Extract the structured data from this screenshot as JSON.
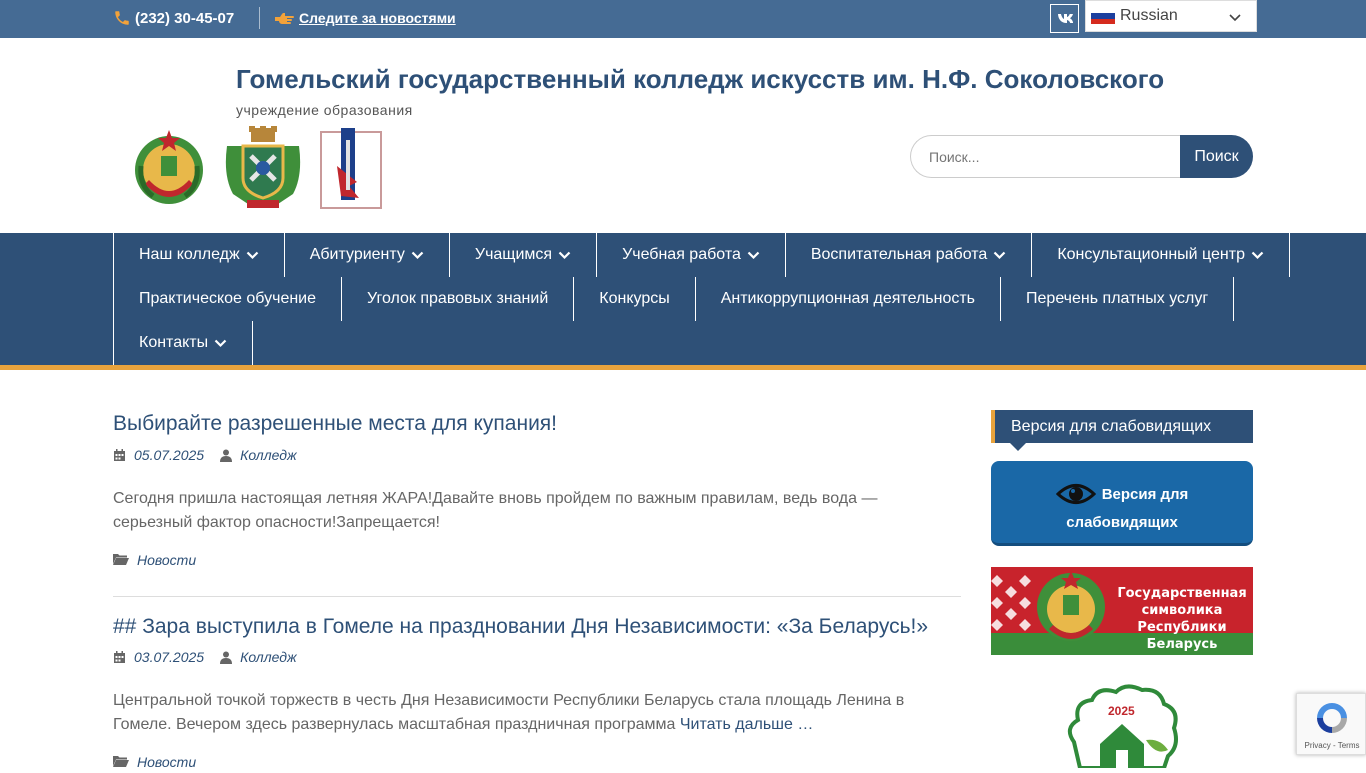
{
  "topbar": {
    "phone": "(232) 30-45-07",
    "news_link": "Следите за новостями",
    "vk_label": "VK",
    "language": "Russian"
  },
  "header": {
    "title": "Гомельский государственный колледж искусств им. Н.Ф. Соколовского",
    "subtitle": "учреждение образования",
    "search_placeholder": "Поиск...",
    "search_button": "Поиск"
  },
  "nav": {
    "row1": [
      {
        "label": "Наш колледж",
        "dropdown": true
      },
      {
        "label": "Абитуриенту",
        "dropdown": true
      },
      {
        "label": "Учащимся",
        "dropdown": true
      },
      {
        "label": "Учебная работа",
        "dropdown": true
      },
      {
        "label": "Воспитательная работа",
        "dropdown": true
      },
      {
        "label": "Консультационный центр",
        "dropdown": true
      }
    ],
    "row2": [
      {
        "label": "Практическое обучение"
      },
      {
        "label": "Уголок правовых знаний"
      },
      {
        "label": "Конкурсы"
      },
      {
        "label": "Антикоррупционная деятельность"
      },
      {
        "label": "Перечень платных услуг"
      }
    ],
    "row3": [
      {
        "label": "Контакты",
        "dropdown": true
      }
    ]
  },
  "posts": [
    {
      "title": "Выбирайте разрешенные места для купания!",
      "date": "05.07.2025",
      "author": "Колледж",
      "excerpt": "Сегодня пришла настоящая летняя ЖАРА!Давайте вновь пройдем по важным правилам, ведь вода — серьезный фактор опасности!Запрещается!",
      "category": "Новости"
    },
    {
      "title": "## Зара выступила в Гомеле на праздновании Дня Независимости: «За Беларусь!»",
      "date": "03.07.2025",
      "author": "Колледж",
      "excerpt": "Центральной точкой торжеств в честь Дня Независимости Республики Беларусь стала площадь Ленина в Гомеле. Вечером здесь развернулась масштабная праздничная программа",
      "read_more": "Читать дальше …",
      "category": "Новости"
    }
  ],
  "sidebar": {
    "widget_title": "Версия для слабовидящих",
    "vi_button_line1": "Версия для",
    "vi_button_line2": "слабовидящих",
    "banner_text": "Государственная символика Республики Беларусь",
    "year_logo": "2025"
  },
  "recaptcha": {
    "terms": "Privacy - Terms"
  },
  "colors": {
    "topbar": "#456b94",
    "primary": "#2e5077",
    "accent": "#e8a33d",
    "vi_button": "#1a68a7"
  }
}
